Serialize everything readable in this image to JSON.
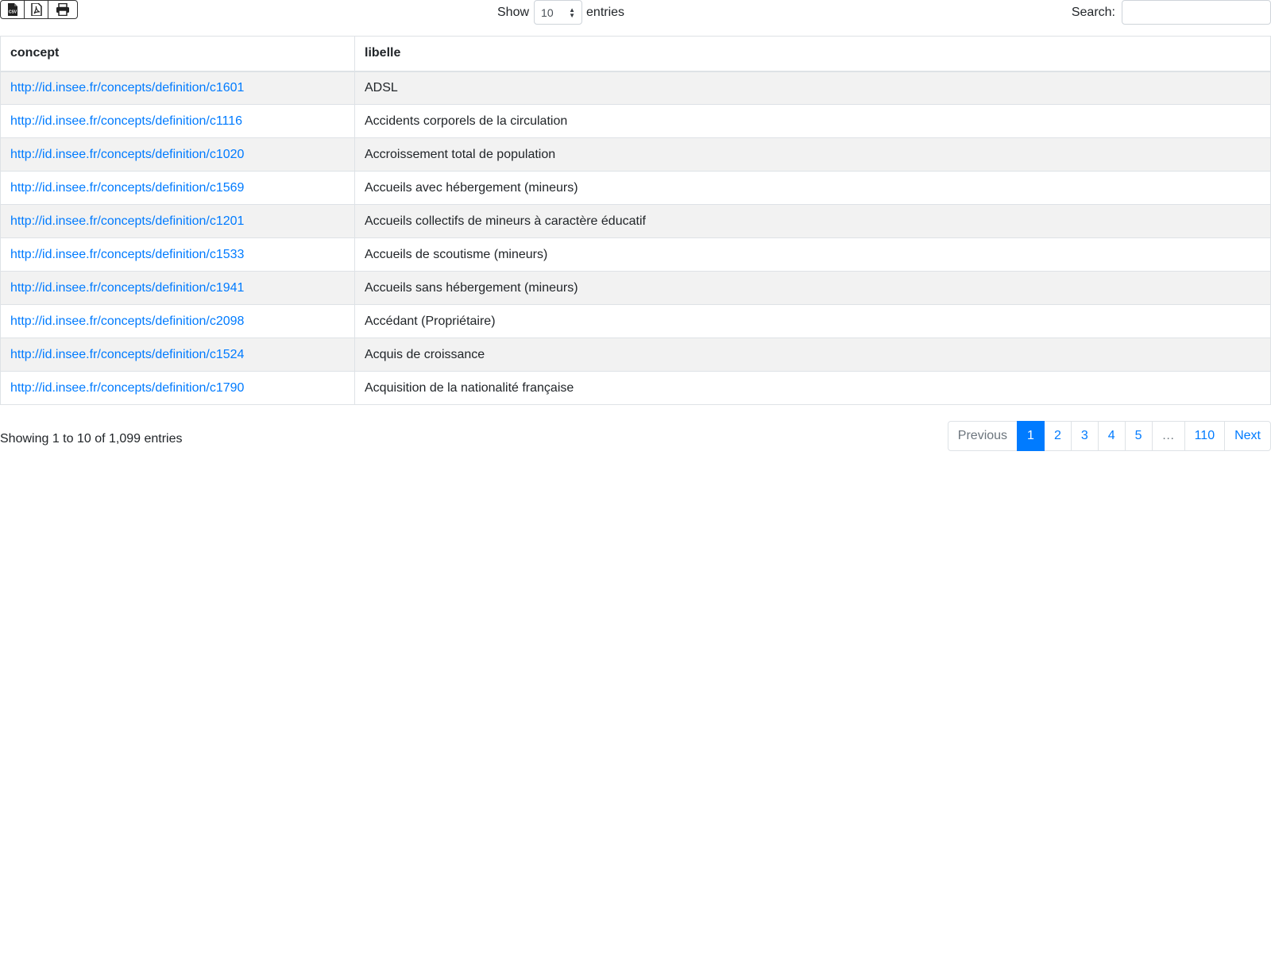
{
  "toolbar": {
    "buttons": [
      {
        "icon": "file-csv-icon",
        "title": "CSV"
      },
      {
        "icon": "file-pdf-icon",
        "title": "PDF"
      },
      {
        "icon": "print-icon",
        "title": "Print"
      }
    ]
  },
  "length": {
    "label_before": "Show",
    "value": "10",
    "label_after": "entries"
  },
  "search": {
    "label": "Search:",
    "value": "",
    "placeholder": ""
  },
  "table": {
    "columns": [
      "concept",
      "libelle"
    ],
    "rows": [
      {
        "concept": "http://id.insee.fr/concepts/definition/c1601",
        "libelle": "ADSL"
      },
      {
        "concept": "http://id.insee.fr/concepts/definition/c1116",
        "libelle": "Accidents corporels de la circulation"
      },
      {
        "concept": "http://id.insee.fr/concepts/definition/c1020",
        "libelle": "Accroissement total de population"
      },
      {
        "concept": "http://id.insee.fr/concepts/definition/c1569",
        "libelle": "Accueils avec hébergement (mineurs)"
      },
      {
        "concept": "http://id.insee.fr/concepts/definition/c1201",
        "libelle": "Accueils collectifs de mineurs à caractère éducatif"
      },
      {
        "concept": "http://id.insee.fr/concepts/definition/c1533",
        "libelle": "Accueils de scoutisme (mineurs)"
      },
      {
        "concept": "http://id.insee.fr/concepts/definition/c1941",
        "libelle": "Accueils sans hébergement (mineurs)"
      },
      {
        "concept": "http://id.insee.fr/concepts/definition/c2098",
        "libelle": "Accédant (Propriétaire)"
      },
      {
        "concept": "http://id.insee.fr/concepts/definition/c1524",
        "libelle": "Acquis de croissance"
      },
      {
        "concept": "http://id.insee.fr/concepts/definition/c1790",
        "libelle": "Acquisition de la nationalité française"
      }
    ]
  },
  "info": "Showing 1 to 10 of 1,099 entries",
  "pagination": {
    "previous": "Previous",
    "pages": [
      "1",
      "2",
      "3",
      "4",
      "5",
      "…",
      "110"
    ],
    "active": "1",
    "next": "Next"
  },
  "colors": {
    "link": "#007bff",
    "active_page": "#007bff",
    "stripe": "#f2f2f2"
  }
}
